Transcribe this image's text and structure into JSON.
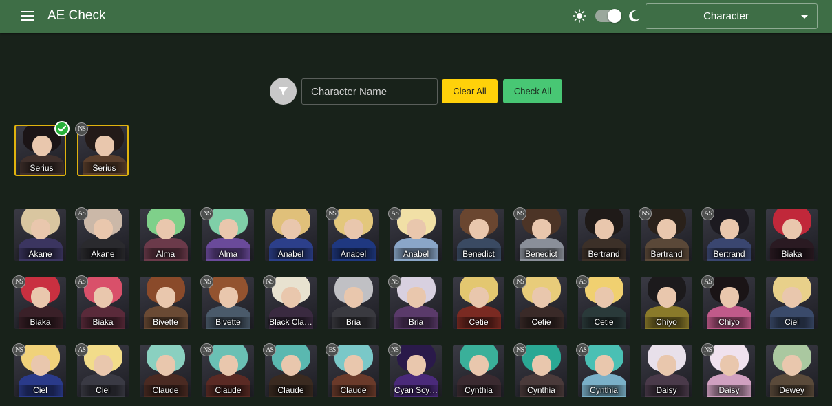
{
  "header": {
    "title": "AE Check",
    "mode_select": "Character"
  },
  "toolbar": {
    "search_placeholder": "Character Name",
    "clear_label": "Clear All",
    "check_label": "Check All"
  },
  "selected": [
    {
      "name": "Serius",
      "badge": "",
      "checked": true,
      "hair": "#1b1416",
      "body": "#40302c"
    },
    {
      "name": "Serius",
      "badge": "NS",
      "checked": false,
      "hair": "#231a18",
      "body": "#5b3f2c"
    }
  ],
  "characters": [
    {
      "name": "Akane",
      "badge": "",
      "hair": "#d9c6a0",
      "body": "#3b3560"
    },
    {
      "name": "Akane",
      "badge": "AS",
      "hair": "#cbb8a8",
      "body": "#2a2a2e"
    },
    {
      "name": "Alma",
      "badge": "",
      "hair": "#7fd08a",
      "body": "#6b3a4a"
    },
    {
      "name": "Alma",
      "badge": "NS",
      "hair": "#7fcfa8",
      "body": "#6a4a9a"
    },
    {
      "name": "Anabel",
      "badge": "",
      "hair": "#e0c07a",
      "body": "#2c3f8a"
    },
    {
      "name": "Anabel",
      "badge": "NS",
      "hair": "#e3c77c",
      "body": "#1f3880"
    },
    {
      "name": "Anabel",
      "badge": "AS",
      "hair": "#f1e0a6",
      "body": "#8aa6c8"
    },
    {
      "name": "Benedict",
      "badge": "",
      "hair": "#6a4630",
      "body": "#3a4a62"
    },
    {
      "name": "Benedict",
      "badge": "NS",
      "hair": "#4c3426",
      "body": "#8a8f99"
    },
    {
      "name": "Bertrand",
      "badge": "",
      "hair": "#1f1a18",
      "body": "#3c3028"
    },
    {
      "name": "Bertrand",
      "badge": "NS",
      "hair": "#2a211a",
      "body": "#5a4838"
    },
    {
      "name": "Bertrand",
      "badge": "AS",
      "hair": "#1c1a20",
      "body": "#3a4670"
    },
    {
      "name": "Biaka",
      "badge": "",
      "hair": "#c1283a",
      "body": "#2a1a22"
    },
    {
      "name": "Biaka",
      "badge": "NS",
      "hair": "#c93040",
      "body": "#3a2028"
    },
    {
      "name": "Biaka",
      "badge": "AS",
      "hair": "#d9506a",
      "body": "#5a2a3a"
    },
    {
      "name": "Bivette",
      "badge": "",
      "hair": "#8a4a2a",
      "body": "#6a4a34"
    },
    {
      "name": "Bivette",
      "badge": "NS",
      "hair": "#93532f",
      "body": "#4a5a6a"
    },
    {
      "name": "Black Cla…",
      "badge": "NS",
      "hair": "#e8e2d0",
      "body": "#3a2a40"
    },
    {
      "name": "Bria",
      "badge": "",
      "hair": "#c0c0c4",
      "body": "#3a3a40"
    },
    {
      "name": "Bria",
      "badge": "NS",
      "hair": "#d8d0e0",
      "body": "#5a3a6a"
    },
    {
      "name": "Cetie",
      "badge": "",
      "hair": "#e3c770",
      "body": "#7a2a22"
    },
    {
      "name": "Cetie",
      "badge": "NS",
      "hair": "#e8cc7a",
      "body": "#3a2a28"
    },
    {
      "name": "Cetie",
      "badge": "AS",
      "hair": "#f0d070",
      "body": "#2a3a3a"
    },
    {
      "name": "Chiyo",
      "badge": "",
      "hair": "#1c1a1c",
      "body": "#8a7a2a"
    },
    {
      "name": "Chiyo",
      "badge": "AS",
      "hair": "#1a1416",
      "body": "#c05a8a"
    },
    {
      "name": "Ciel",
      "badge": "",
      "hair": "#e8d08a",
      "body": "#3a4a6a"
    },
    {
      "name": "Ciel",
      "badge": "NS",
      "hair": "#f0d27a",
      "body": "#2a3a8a"
    },
    {
      "name": "Ciel",
      "badge": "AS",
      "hair": "#f2dc8a",
      "body": "#3a3a44"
    },
    {
      "name": "Claude",
      "badge": "",
      "hair": "#8ad0c0",
      "body": "#4a2a22"
    },
    {
      "name": "Claude",
      "badge": "NS",
      "hair": "#6ac0b4",
      "body": "#5a2a24"
    },
    {
      "name": "Claude",
      "badge": "AS",
      "hair": "#5ab8b0",
      "body": "#3a2a20"
    },
    {
      "name": "Claude",
      "badge": "ES",
      "hair": "#7ac8c8",
      "body": "#6a3a2a"
    },
    {
      "name": "Cyan Scy…",
      "badge": "NS",
      "hair": "#2a1a4a",
      "body": "#4a2a7a"
    },
    {
      "name": "Cynthia",
      "badge": "",
      "hair": "#3ab09a",
      "body": "#3a2a30"
    },
    {
      "name": "Cynthia",
      "badge": "NS",
      "hair": "#2aa894",
      "body": "#4a3a3a"
    },
    {
      "name": "Cynthia",
      "badge": "AS",
      "hair": "#4ac0b4",
      "body": "#7ab0c8"
    },
    {
      "name": "Daisy",
      "badge": "",
      "hair": "#e8e0ea",
      "body": "#4a3a4a"
    },
    {
      "name": "Daisy",
      "badge": "NS",
      "hair": "#f0e2ee",
      "body": "#d0a0c0"
    },
    {
      "name": "Dewey",
      "badge": "",
      "hair": "#aac8a0",
      "body": "#5a4a3a"
    }
  ],
  "colors": {
    "topbar": "#3e6e46",
    "background": "#18221a",
    "clear_button": "#ffd10a",
    "check_button": "#48c774",
    "selected_border": "#e0b30e"
  }
}
